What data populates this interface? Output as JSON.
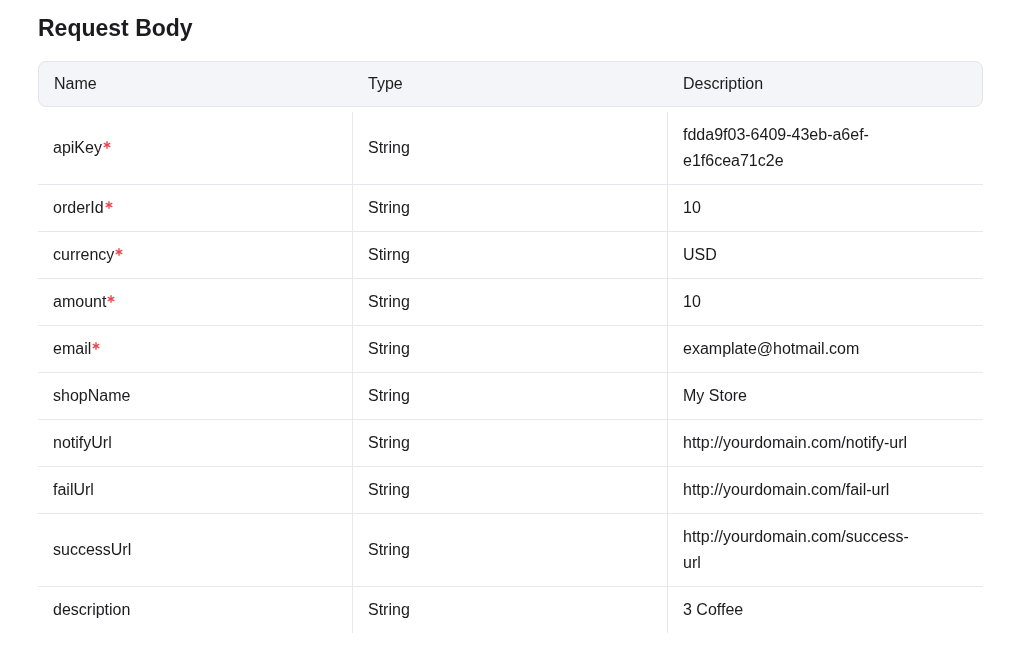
{
  "title": "Request Body",
  "table": {
    "columns": [
      "Name",
      "Type",
      "Description"
    ],
    "rows": [
      {
        "name": "apiKey",
        "required": true,
        "type": "String",
        "description": "fdda9f03-6409-43eb-a6ef-e1f6cea71c2e"
      },
      {
        "name": "orderId",
        "required": true,
        "type": "String",
        "description": "10"
      },
      {
        "name": "currency",
        "required": true,
        "type": "Stirng",
        "description": "USD"
      },
      {
        "name": "amount",
        "required": true,
        "type": "String",
        "description": "10"
      },
      {
        "name": "email",
        "required": true,
        "type": "String",
        "description": "examplate@hotmail.com"
      },
      {
        "name": "shopName",
        "required": false,
        "type": "String",
        "description": "My Store"
      },
      {
        "name": "notifyUrl",
        "required": false,
        "type": "String",
        "description": "http://yourdomain.com/notify-url"
      },
      {
        "name": "failUrl",
        "required": false,
        "type": "String",
        "description": "http://yourdomain.com/fail-url"
      },
      {
        "name": "successUrl",
        "required": false,
        "type": "String",
        "description": "http://yourdomain.com/success-url"
      },
      {
        "name": "description",
        "required": false,
        "type": "String",
        "description": "3 Coffee"
      }
    ]
  }
}
